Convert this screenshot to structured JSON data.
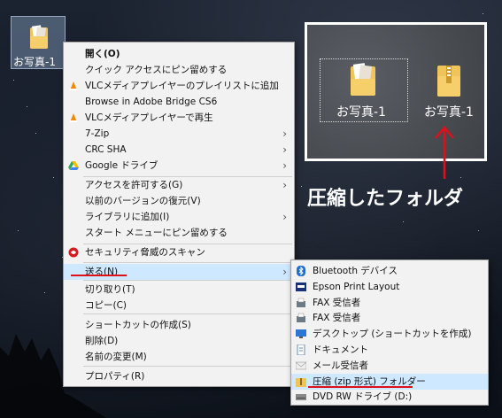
{
  "desktop": {
    "icon_label": "お写真-1"
  },
  "context_menu": {
    "items": [
      {
        "label": "開く(O)",
        "bold": true,
        "arrow": ""
      },
      {
        "label": "クイック アクセスにピン留めする",
        "arrow": ""
      },
      {
        "label": "VLCメディアプレイヤーのプレイリストに追加",
        "icon": "vlc-icon",
        "arrow": ""
      },
      {
        "label": "Browse in Adobe Bridge CS6",
        "arrow": ""
      },
      {
        "label": "VLCメディアプレイヤーで再生",
        "icon": "vlc-icon",
        "arrow": ""
      },
      {
        "label": "7-Zip",
        "arrow": "›"
      },
      {
        "label": "CRC SHA",
        "arrow": "›"
      },
      {
        "label": "Google ドライブ",
        "icon": "google-drive-icon",
        "arrow": "›"
      },
      {
        "label": "アクセスを許可する(G)",
        "arrow": "›"
      },
      {
        "label": "以前のバージョンの復元(V)",
        "arrow": ""
      },
      {
        "label": "ライブラリに追加(I)",
        "arrow": "›"
      },
      {
        "label": "スタート メニューにピン留めする",
        "arrow": ""
      },
      {
        "label": "セキュリティ脅威のスキャン",
        "icon": "security-scan-icon",
        "arrow": ""
      },
      {
        "label": "送る(N)",
        "arrow": "›"
      },
      {
        "label": "切り取り(T)",
        "arrow": ""
      },
      {
        "label": "コピー(C)",
        "arrow": ""
      },
      {
        "label": "ショートカットの作成(S)",
        "arrow": ""
      },
      {
        "label": "削除(D)",
        "arrow": ""
      },
      {
        "label": "名前の変更(M)",
        "arrow": ""
      },
      {
        "label": "プロパティ(R)",
        "arrow": ""
      }
    ]
  },
  "sendto_menu": {
    "items": [
      {
        "label": "Bluetooth デバイス",
        "icon": "bluetooth-icon"
      },
      {
        "label": "Epson Print Layout",
        "icon": "epson-icon"
      },
      {
        "label": "FAX 受信者",
        "icon": "fax-icon"
      },
      {
        "label": "FAX 受信者",
        "icon": "fax-icon"
      },
      {
        "label": "デスクトップ (ショートカットを作成)",
        "icon": "desktop-icon"
      },
      {
        "label": "ドキュメント",
        "icon": "document-icon"
      },
      {
        "label": "メール受信者",
        "icon": "mail-icon"
      },
      {
        "label": "圧縮 (zip 形式) フォルダー",
        "icon": "zip-folder-icon"
      },
      {
        "label": "DVD RW ドライブ (D:)",
        "icon": "dvd-drive-icon"
      }
    ]
  },
  "inset": {
    "left_label": "お写真-1",
    "right_label": "お写真-1",
    "annotation": "圧縮したフォルダ"
  },
  "colors": {
    "accent_red": "#e0101a",
    "highlight": "#cde8ff",
    "menu_bg": "#f2f2f2"
  }
}
